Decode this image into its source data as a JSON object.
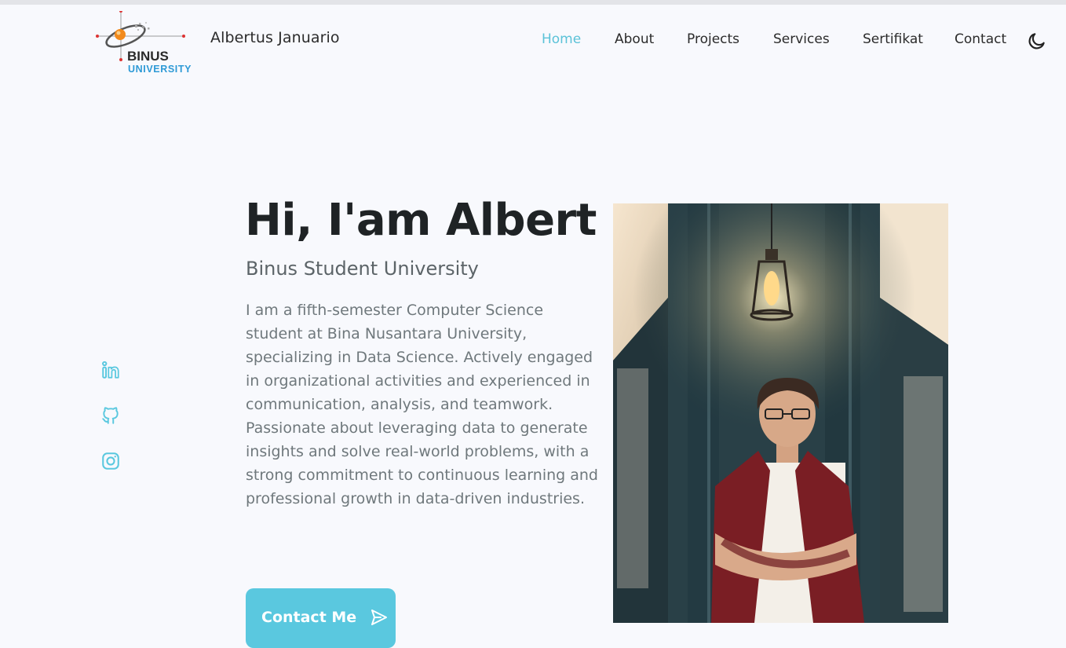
{
  "header": {
    "logo": {
      "title": "BINUS",
      "subtitle": "UNIVERSITY"
    },
    "brand_name": "Albertus Januario",
    "nav": [
      {
        "label": "Home",
        "active": true
      },
      {
        "label": "About",
        "active": false
      },
      {
        "label": "Projects",
        "active": false
      },
      {
        "label": "Services",
        "active": false
      },
      {
        "label": "Sertifikat",
        "active": false
      },
      {
        "label": "Contact",
        "active": false
      }
    ],
    "theme_toggle_icon": "moon-icon"
  },
  "social": [
    {
      "icon": "linkedin-icon"
    },
    {
      "icon": "github-icon"
    },
    {
      "icon": "instagram-icon"
    }
  ],
  "hero": {
    "title": "Hi, I'am Albert",
    "subtitle": "Binus Student University",
    "description": "I am a fifth-semester Computer Science student at Bina Nusantara University, specializing in Data Science. Actively engaged in organizational activities and experienced in communication, analysis, and teamwork. Passionate about leveraging data to generate insights and solve real-world problems, with a strong commitment to continuous learning and professional growth in data-driven industries.",
    "cta_label": "Contact Me",
    "cta_icon": "send-icon"
  },
  "colors": {
    "accent": "#5ac8df",
    "background": "#f8f9fd",
    "heading": "#1f2325",
    "subtitle": "#5c6468",
    "body_text": "#6f787c"
  }
}
